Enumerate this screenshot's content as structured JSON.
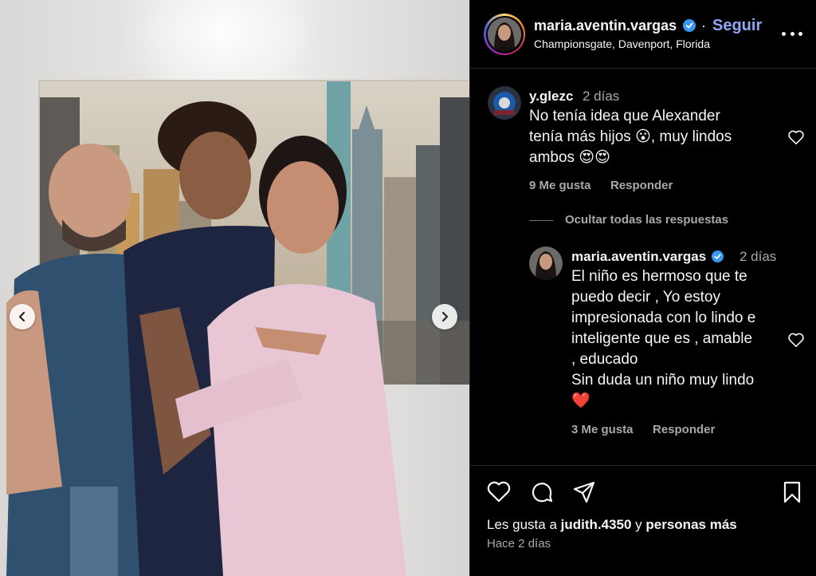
{
  "post": {
    "author": "maria.aventin.vargas",
    "follow_label": "Seguir",
    "separator": "·",
    "location": "Championsgate, Davenport, Florida"
  },
  "comments": [
    {
      "user": "y.glezc",
      "time": "2 días",
      "text_lines": [
        "No tenía idea que Alexander",
        "tenía más hijos 😮, muy lindos",
        "ambos 😍😍"
      ],
      "likes": "9 Me gusta",
      "reply_label": "Responder"
    }
  ],
  "replies_toggle": "Ocultar todas las respuestas",
  "reply": {
    "user": "maria.aventin.vargas",
    "time": "2 días",
    "text_lines": [
      "El niño es hermoso que te",
      "puedo decir , Yo estoy",
      "impresionada con lo lindo e",
      "inteligente que es , amable",
      ", educado",
      "Sin duda un niño muy lindo",
      "❤️"
    ],
    "likes": "3 Me gusta",
    "reply_label": "Responder"
  },
  "footer": {
    "likes_prefix": "Les gusta a ",
    "likes_user": "judith.4350",
    "likes_mid": " y ",
    "likes_rest": "personas más",
    "date": "Hace 2 días"
  },
  "colors": {
    "background": "#000000",
    "follow_link": "#8ea8f6",
    "verified_badge": "#3897f0",
    "muted_text": "#a8a8a8"
  },
  "icons": [
    "chevron-left-icon",
    "chevron-right-icon",
    "verified-badge-icon",
    "more-options-icon",
    "heart-icon",
    "comment-icon",
    "share-icon",
    "bookmark-icon"
  ]
}
